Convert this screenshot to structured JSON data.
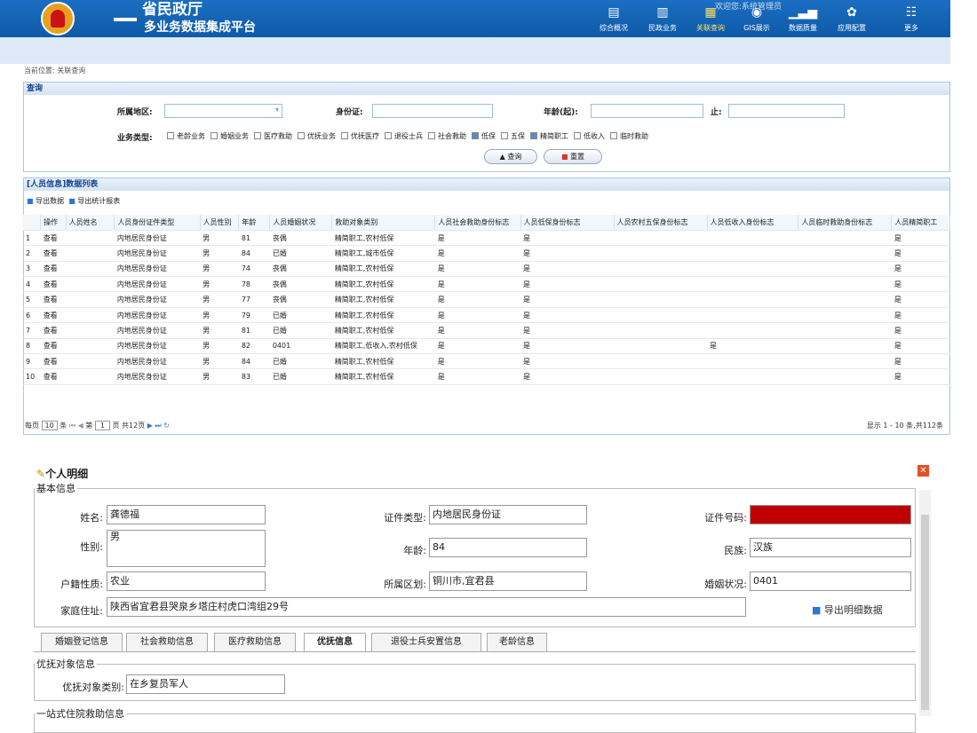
{
  "header": {
    "org": "省民政厅",
    "subtitle": "多业务数据集成平台",
    "top_links": "欢迎您:系统管理员",
    "nav": [
      {
        "label": "综合概况",
        "icon": "▤"
      },
      {
        "label": "民政业务",
        "icon": "▥"
      },
      {
        "label": "关联查询",
        "icon": "▦"
      },
      {
        "label": "GIS展示",
        "icon": "◉"
      },
      {
        "label": "数据质量",
        "icon": "▁▃▅"
      },
      {
        "label": "应用配置",
        "icon": "✿"
      },
      {
        "label": "更多",
        "icon": "☷"
      }
    ]
  },
  "breadcrumb": {
    "prefix": "当前位置:",
    "current": "关联查询"
  },
  "query": {
    "title": "查询",
    "region_label": "所属地区:",
    "id_label": "身份证:",
    "age_from_label": "年龄(起):",
    "age_to_label": "止:",
    "type_label": "业务类型:",
    "types": [
      {
        "label": "老龄业务",
        "on": false
      },
      {
        "label": "婚姻业务",
        "on": false
      },
      {
        "label": "医疗救助",
        "on": false
      },
      {
        "label": "优抚业务",
        "on": false
      },
      {
        "label": "优抚医疗",
        "on": false
      },
      {
        "label": "退役士兵",
        "on": false
      },
      {
        "label": "社会救助",
        "on": false
      },
      {
        "label": "低保",
        "on": true
      },
      {
        "label": "五保",
        "on": false
      },
      {
        "label": "精简职工",
        "on": true
      },
      {
        "label": "低收入",
        "on": false
      },
      {
        "label": "临时救助",
        "on": false
      }
    ],
    "search_btn": "查询",
    "reset_btn": "重置"
  },
  "list": {
    "title": "[人员信息]数据列表",
    "export_btn": "导出数据",
    "export_stat_btn": "导出统计报表",
    "columns": [
      "",
      "操作",
      "人员姓名",
      "人员身份证件类型",
      "人员性别",
      "年龄",
      "人员婚姻状况",
      "救助对象类别",
      "人员社会救助身份标志",
      "人员低保身份标志",
      "人员农村五保身份标志",
      "人员低收入身份标志",
      "人员临时救助身份标志",
      "人员精简职工"
    ],
    "rows": [
      [
        "1",
        "查看",
        "",
        "内地居民身份证",
        "男",
        "81",
        "丧偶",
        "精简职工,农村低保",
        "是",
        "是",
        "",
        "",
        "",
        "是"
      ],
      [
        "2",
        "查看",
        "",
        "内地居民身份证",
        "男",
        "84",
        "已婚",
        "精简职工,城市低保",
        "是",
        "是",
        "",
        "",
        "",
        "是"
      ],
      [
        "3",
        "查看",
        "",
        "内地居民身份证",
        "男",
        "74",
        "丧偶",
        "精简职工,农村低保",
        "是",
        "是",
        "",
        "",
        "",
        "是"
      ],
      [
        "4",
        "查看",
        "",
        "内地居民身份证",
        "男",
        "78",
        "丧偶",
        "精简职工,农村低保",
        "是",
        "是",
        "",
        "",
        "",
        "是"
      ],
      [
        "5",
        "查看",
        "",
        "内地居民身份证",
        "男",
        "77",
        "丧偶",
        "精简职工,农村低保",
        "是",
        "是",
        "",
        "",
        "",
        "是"
      ],
      [
        "6",
        "查看",
        "",
        "内地居民身份证",
        "男",
        "79",
        "已婚",
        "精简职工,农村低保",
        "是",
        "是",
        "",
        "",
        "",
        "是"
      ],
      [
        "7",
        "查看",
        "",
        "内地居民身份证",
        "男",
        "81",
        "已婚",
        "精简职工,农村低保",
        "是",
        "是",
        "",
        "",
        "",
        "是"
      ],
      [
        "8",
        "查看",
        "",
        "内地居民身份证",
        "男",
        "82",
        "0401",
        "精简职工,低收入,农村低保",
        "是",
        "是",
        "",
        "是",
        "",
        "是"
      ],
      [
        "9",
        "查看",
        "",
        "内地居民身份证",
        "男",
        "84",
        "已婚",
        "精简职工,农村低保",
        "是",
        "是",
        "",
        "",
        "",
        "是"
      ],
      [
        "10",
        "查看",
        "",
        "内地居民身份证",
        "男",
        "83",
        "已婚",
        "精简职工,农村低保",
        "是",
        "是",
        "",
        "",
        "",
        "是"
      ]
    ]
  },
  "pager": {
    "per_page": "每页",
    "size": "10",
    "unit": "条",
    "page_prefix": "第",
    "page": "1",
    "page_suffix": "页 共12页",
    "summary": "显示 1 - 10 条,共112条"
  },
  "detail": {
    "title": "个人明细",
    "basic_legend": "基本信息",
    "name_label": "姓名:",
    "name": "龚德福",
    "id_type_label": "证件类型:",
    "id_type": "内地居民身份证",
    "id_no_label": "证件号码:",
    "sex_label": "性别:",
    "sex": "男",
    "age_label": "年龄:",
    "age": "84",
    "nation_label": "民族:",
    "nation": "汉族",
    "hukou_label": "户籍性质:",
    "hukou": "农业",
    "area_label": "所属区划:",
    "area": "铜川市,宜君县",
    "marriage_label": "婚姻状况:",
    "marriage": "0401",
    "addr_label": "家庭住址:",
    "addr": "陕西省宜君县哭泉乡塔庄村虎口湾组29号",
    "export_detail": "导出明细数据",
    "tabs": [
      "婚姻登记信息",
      "社会救助信息",
      "医疗救助信息",
      "优抚信息",
      "退役士兵安置信息",
      "老龄信息"
    ],
    "yf_legend": "优抚对象信息",
    "yf_label": "优抚对象类别:",
    "yf_value": "在乡复员军人",
    "hosp_legend": "一站式住院救助信息"
  }
}
